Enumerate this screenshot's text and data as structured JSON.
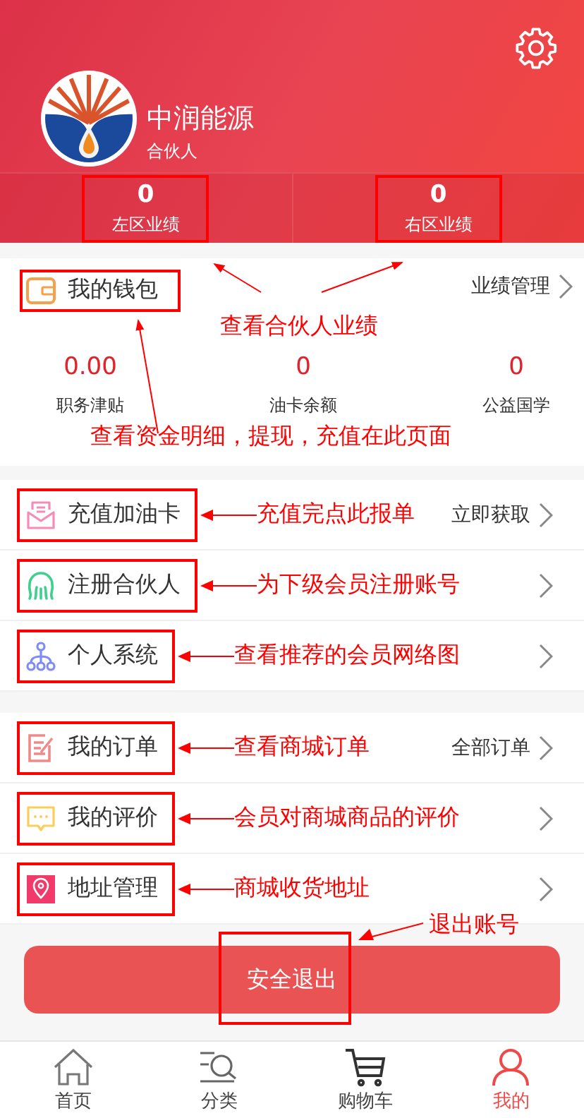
{
  "header": {
    "brand": "中润能源",
    "role": "合伙人",
    "stats": [
      {
        "value": "0",
        "label": "左区业绩"
      },
      {
        "value": "0",
        "label": "右区业绩"
      }
    ]
  },
  "wallet": {
    "title": "我的钱包",
    "link": "业绩管理",
    "note": "查看合伙人业绩",
    "note_bottom": "查看资金明细，提现，充值在此页面",
    "stats": [
      {
        "value": "0.00",
        "label": "职务津贴"
      },
      {
        "value": "0",
        "label": "油卡余额"
      },
      {
        "value": "0",
        "label": "公益国学"
      }
    ]
  },
  "menu_groups": [
    [
      {
        "kind": "recharge",
        "label": "充值加油卡",
        "right": "立即获取",
        "note": "充值完点此报单"
      },
      {
        "kind": "register",
        "label": "注册合伙人",
        "note": "为下级会员注册账号"
      },
      {
        "kind": "network",
        "label": "个人系统",
        "note": "查看推荐的会员网络图"
      }
    ],
    [
      {
        "kind": "orders",
        "label": "我的订单",
        "right": "全部订单",
        "note": "查看商城订单"
      },
      {
        "kind": "reviews",
        "label": "我的评价",
        "note": "会员对商城商品的评价"
      },
      {
        "kind": "address",
        "label": "地址管理",
        "note": "商城收货地址"
      }
    ]
  ],
  "logout": {
    "label": "安全退出",
    "note": "退出账号"
  },
  "tabbar": [
    {
      "kind": "home",
      "label": "首页",
      "selected": false
    },
    {
      "kind": "category",
      "label": "分类",
      "selected": false
    },
    {
      "kind": "cart",
      "label": "购物车",
      "selected": false
    },
    {
      "kind": "me",
      "label": "我的",
      "selected": true
    }
  ]
}
